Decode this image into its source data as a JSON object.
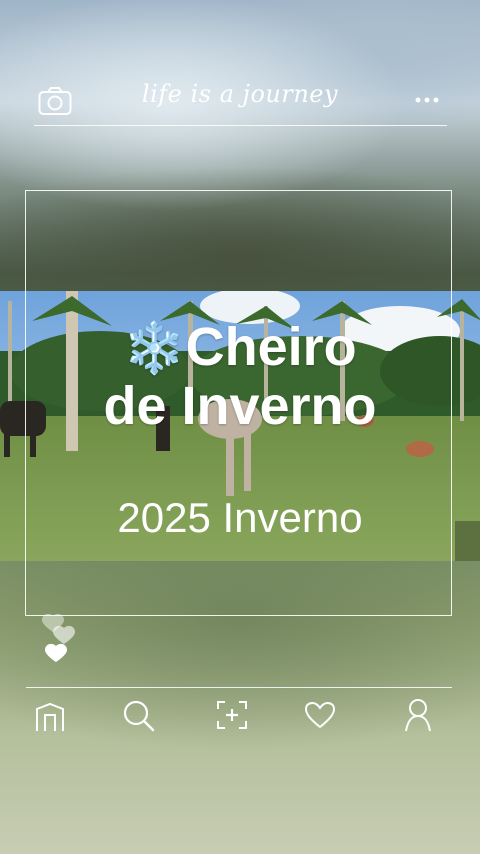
{
  "header": {
    "tagline": "life is a journey",
    "camera_icon": "camera-icon",
    "more_icon": "more-dots-icon"
  },
  "card": {
    "emoji": "❄️",
    "title_line1": "Cheiro",
    "title_line2": "de Inverno",
    "subtitle": "2025 Inverno"
  },
  "nav": {
    "items": [
      {
        "icon": "home-icon"
      },
      {
        "icon": "search-icon"
      },
      {
        "icon": "add-photo-icon"
      },
      {
        "icon": "heart-icon"
      },
      {
        "icon": "profile-icon"
      }
    ]
  },
  "colors": {
    "line": "#ffffff",
    "sky": "#8fb8e0",
    "grass": "#7e9a5a"
  }
}
